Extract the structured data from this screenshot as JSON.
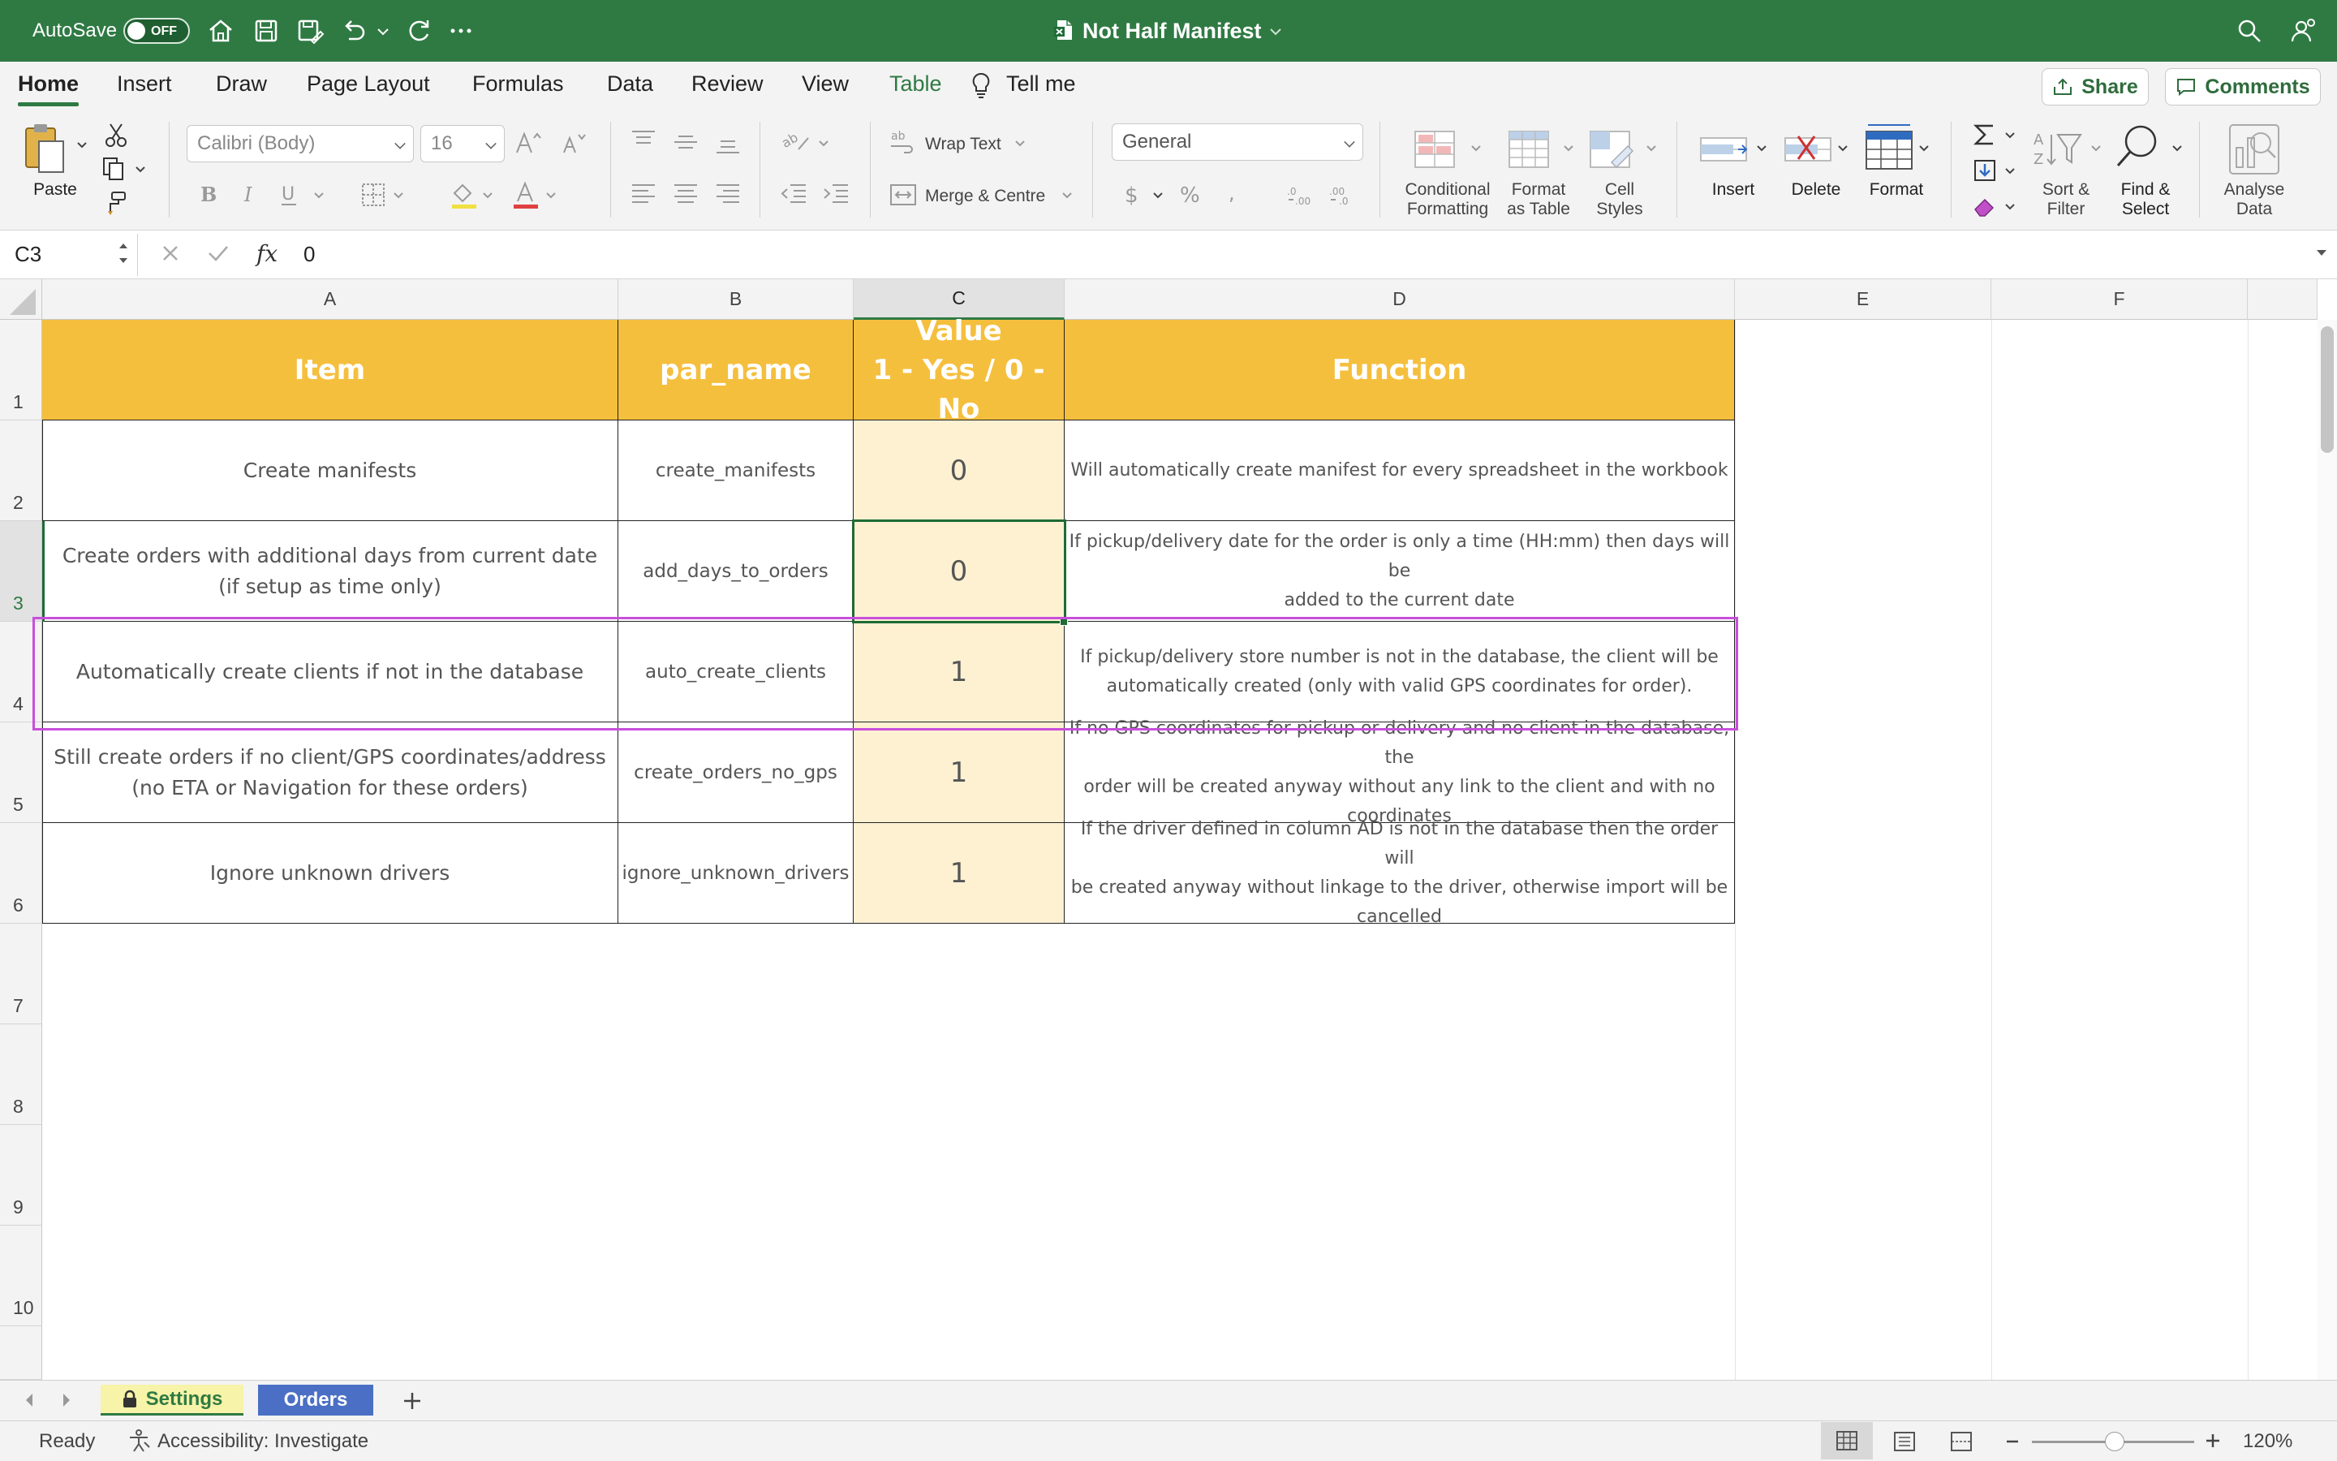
{
  "window": {
    "autosave_label": "AutoSave",
    "autosave_state": "OFF",
    "document_title": "Not Half Manifest"
  },
  "ribbon_tabs": [
    "Home",
    "Insert",
    "Draw",
    "Page Layout",
    "Formulas",
    "Data",
    "Review",
    "View",
    "Table"
  ],
  "tell_me": "Tell me",
  "share_label": "Share",
  "comments_label": "Comments",
  "ribbon": {
    "paste": "Paste",
    "font_name": "Calibri (Body)",
    "font_size": "16",
    "wrap_text": "Wrap Text",
    "merge_centre": "Merge & Centre",
    "number_format": "General",
    "conditional_formatting": [
      "Conditional",
      "Formatting"
    ],
    "format_as_table": [
      "Format",
      "as Table"
    ],
    "cell_styles": [
      "Cell",
      "Styles"
    ],
    "insert": "Insert",
    "delete": "Delete",
    "format": "Format",
    "sort_filter": [
      "Sort &",
      "Filter"
    ],
    "find_select": [
      "Find &",
      "Select"
    ],
    "analyse_data": [
      "Analyse",
      "Data"
    ]
  },
  "formula_bar": {
    "name_box": "C3",
    "content": "0"
  },
  "columns": [
    "A",
    "B",
    "C",
    "D",
    "E",
    "F"
  ],
  "rows": [
    "1",
    "2",
    "3",
    "4",
    "5",
    "6",
    "7",
    "8",
    "9",
    "10"
  ],
  "table": {
    "headers": {
      "item": "Item",
      "par_name": "par_name",
      "value_line1": "Value",
      "value_line2": "1 - Yes / 0 - No",
      "function": "Function"
    },
    "rows": [
      {
        "item": [
          "Create manifests"
        ],
        "par_name": "create_manifests",
        "value": "0",
        "function": [
          "Will automatically create manifest for every spreadsheet in the workbook"
        ]
      },
      {
        "item": [
          "Create orders with additional days from current date",
          "(if setup as time only)"
        ],
        "par_name": "add_days_to_orders",
        "value": "0",
        "function": [
          "If pickup/delivery date for the order is only a time (HH:mm) then days will be",
          "added to the current date"
        ]
      },
      {
        "item": [
          "Automatically create clients if not in the database"
        ],
        "par_name": "auto_create_clients",
        "value": "1",
        "function": [
          "If pickup/delivery store number is not in the database, the client will be",
          "automatically created (only with valid GPS coordinates for order)."
        ]
      },
      {
        "item": [
          "Still create orders if no client/GPS coordinates/address",
          "(no ETA or Navigation for these orders)"
        ],
        "par_name": "create_orders_no_gps",
        "value": "1",
        "function": [
          "If no GPS coordinates for pickup or delivery and no client in the database, the",
          "order will be created anyway without any link to the client and with no",
          "coordinates"
        ]
      },
      {
        "item": [
          "Ignore unknown drivers"
        ],
        "par_name": "ignore_unknown_drivers",
        "value": "1",
        "function": [
          "If the driver defined in column AD is not in the database then the order will",
          "be created anyway without linkage to the driver, otherwise import will be",
          "cancelled"
        ]
      }
    ]
  },
  "sheets": [
    {
      "name": "Settings",
      "locked": true
    },
    {
      "name": "Orders",
      "locked": false
    }
  ],
  "status": {
    "ready": "Ready",
    "accessibility": "Accessibility: Investigate",
    "zoom": "120%"
  },
  "colors": {
    "title_green": "#2f7a43",
    "header_yellow": "#f5bf3e",
    "value_fill": "#fdf1d2",
    "selection_highlight": "#c84fdc",
    "orders_tab": "#4a6fc4",
    "settings_tab": "#f7f3a8"
  }
}
